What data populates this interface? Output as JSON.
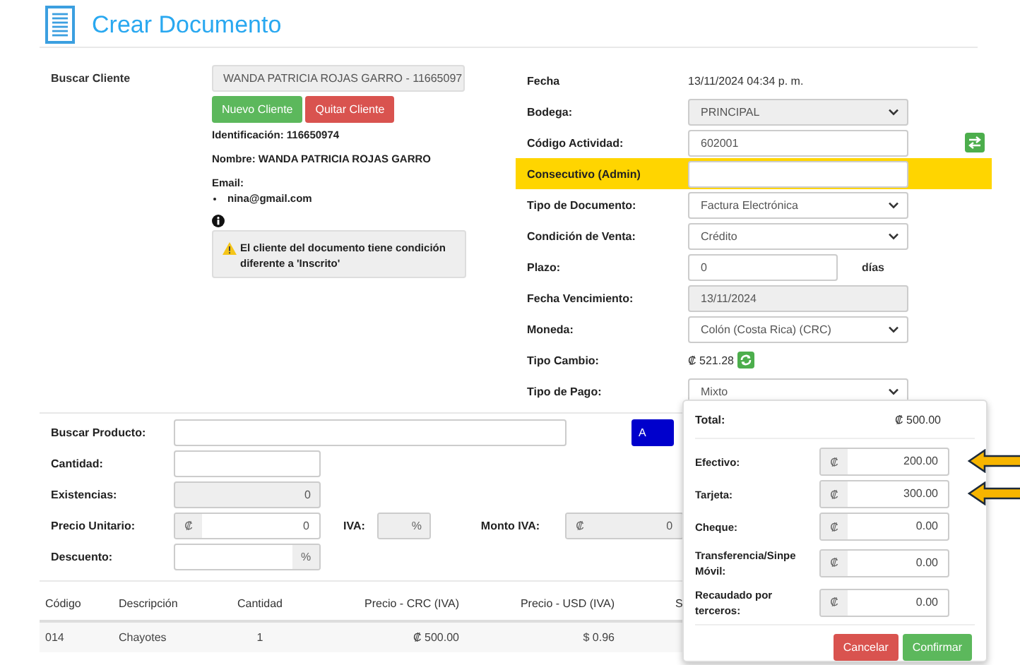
{
  "header": {
    "title": "Crear Documento"
  },
  "customer": {
    "label": "Buscar Cliente",
    "search_value": "WANDA PATRICIA ROJAS GARRO - 11665097",
    "buttons": [
      {
        "label": "Nuevo Cliente",
        "kind": "success"
      },
      {
        "label": "Quitar Cliente",
        "kind": "danger"
      }
    ],
    "identification": "Identificación: 116650974",
    "name": "Nombre: WANDA PATRICIA ROJAS GARRO",
    "email_label": "Email:",
    "emails": [
      "nina@gmail.com"
    ],
    "notice": "El cliente del documento tiene condición diferente a 'Inscrito'"
  },
  "document_fields": [
    {
      "label": "Fecha",
      "kind": "text",
      "value": "13/11/2024 04:34 p. m.",
      "highlighted": false
    },
    {
      "label": "Bodega:",
      "kind": "select",
      "value": "PRINCIPAL",
      "disabled": true,
      "highlighted": false
    },
    {
      "label": "Código Actividad:",
      "kind": "input_action",
      "value": "602001",
      "disabled": false,
      "highlighted": false
    },
    {
      "label": "Consecutivo (Admin)",
      "kind": "input",
      "disabled": false,
      "highlighted": true
    },
    {
      "label": "Tipo de Documento:",
      "kind": "select",
      "value": "Factura Electrónica",
      "disabled": false,
      "highlighted": false
    },
    {
      "label": "Condición de Venta:",
      "kind": "select",
      "value": "Crédito",
      "disabled": false,
      "highlighted": false
    },
    {
      "label": "Plazo:",
      "kind": "input_unit",
      "value": "0",
      "unit": "días",
      "disabled": false,
      "highlighted": false
    },
    {
      "label": "Fecha Vencimiento:",
      "kind": "input",
      "value": "13/11/2024",
      "disabled": true,
      "highlighted": false
    },
    {
      "label": "Moneda:",
      "kind": "select",
      "value": "Colón (Costa Rica) (CRC)",
      "disabled": false,
      "highlighted": false
    },
    {
      "label": "Tipo Cambio:",
      "kind": "text_refresh",
      "value": "₡ 521.28",
      "highlighted": false
    },
    {
      "label": "Tipo de Pago:",
      "kind": "select",
      "value": "Mixto",
      "disabled": false,
      "highlighted": false
    }
  ],
  "product_form": {
    "rows": [
      [
        {
          "label": "Buscar Producto:",
          "kind": "search",
          "disabled": false
        }
      ],
      [
        {
          "label": "Cantidad:",
          "kind": "input",
          "disabled": false
        }
      ],
      [
        {
          "label": "Existencias:",
          "kind": "input",
          "value": "0",
          "disabled": true
        }
      ],
      [
        {
          "label": "Precio Unitario:",
          "kind": "prefix",
          "addon": "₡",
          "value": "0",
          "disabled": false
        },
        {
          "label": "IVA:",
          "kind": "suffix",
          "addon": "%",
          "disabled": true
        },
        {
          "label": "Monto IVA:",
          "kind": "prefix",
          "addon": "₡",
          "value": "0",
          "disabled": true
        }
      ],
      [
        {
          "label": "Descuento:",
          "kind": "suffix",
          "addon": "%",
          "disabled": false
        }
      ]
    ],
    "add_button": "A"
  },
  "table": {
    "columns": [
      "Código",
      "Descripción",
      "Cantidad",
      "Precio - CRC (IVA)",
      "Precio - USD (IVA)",
      "S"
    ],
    "rows": [
      {
        "cells": [
          "014",
          "Chayotes",
          "1",
          "₡ 500.00",
          "$ 0.96"
        ]
      }
    ]
  },
  "payment_popover": {
    "total_label": "Total:",
    "total_value": "₡ 500.00",
    "methods": [
      {
        "label": "Efectivo:",
        "currency": "₡",
        "value": "200.00",
        "pointed": true
      },
      {
        "label": "Tarjeta:",
        "currency": "₡",
        "value": "300.00",
        "pointed": true
      },
      {
        "label": "Cheque:",
        "currency": "₡",
        "value": "0.00",
        "pointed": false
      },
      {
        "label": "Transferencia/Sinpe Móvil:",
        "currency": "₡",
        "value": "0.00",
        "pointed": false
      },
      {
        "label": "Recaudado por terceros:",
        "currency": "₡",
        "value": "0.00",
        "pointed": false
      }
    ],
    "buttons": [
      {
        "label": "Cancelar",
        "kind": "danger"
      },
      {
        "label": "Confirmar",
        "kind": "success"
      }
    ]
  }
}
